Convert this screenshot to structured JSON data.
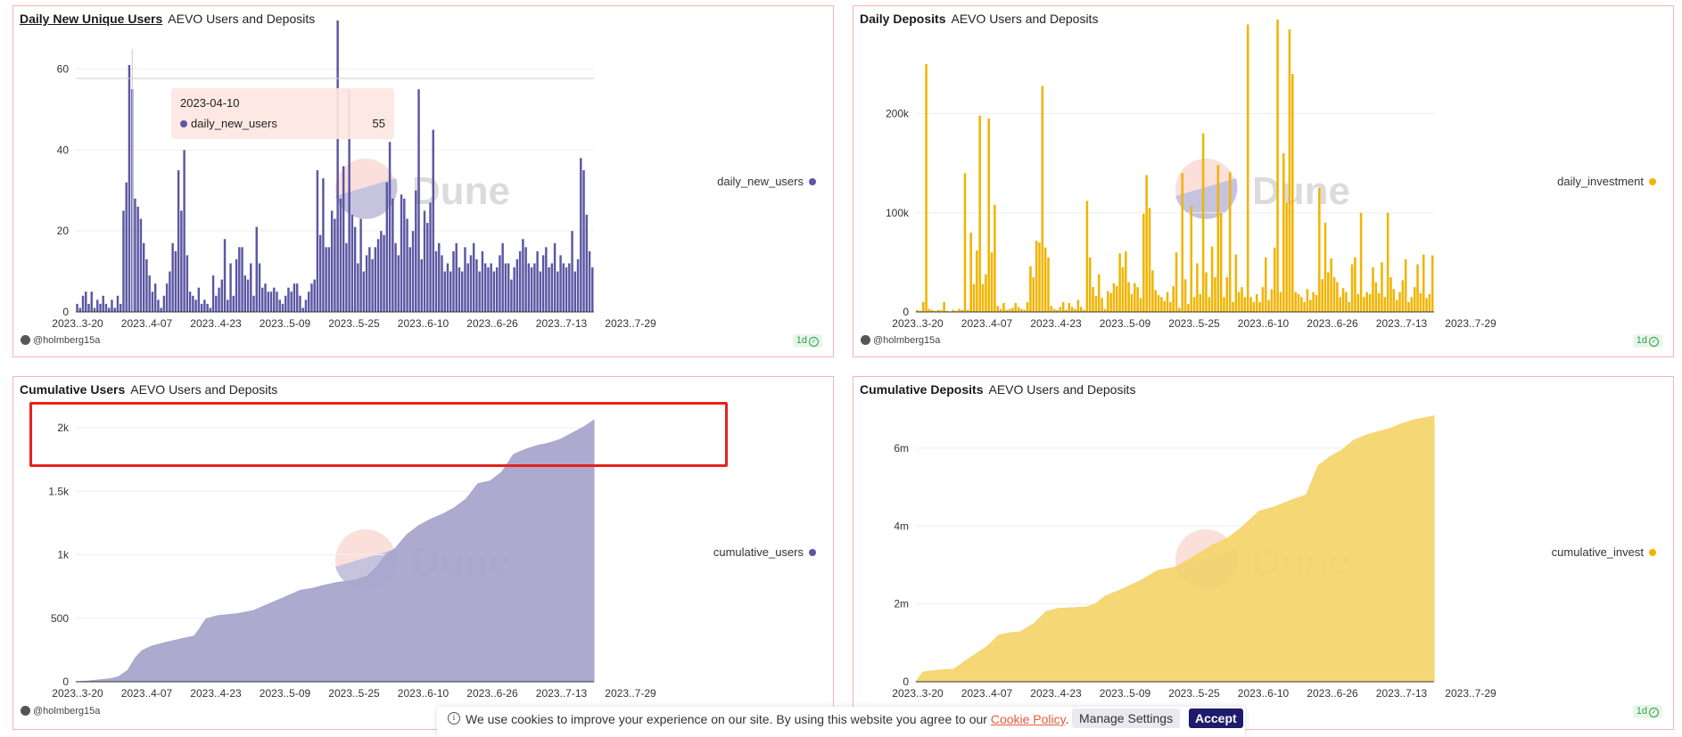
{
  "colors": {
    "purple": "#5b57a3",
    "purple_area": "#a8a6cc",
    "gold": "#f0b400",
    "gold_area": "#f5d56e",
    "panel_border": "#f4b4b0",
    "highlight": "#e5221d"
  },
  "panels": [
    {
      "title": "Daily New Unique Users",
      "subtitle": "AEVO Users and Deposits",
      "legend": "daily_new_users",
      "author": "@holmberg15a",
      "badge": "1d",
      "tooltip": {
        "date": "2023-04-10",
        "series": "daily_new_users",
        "value": "55"
      }
    },
    {
      "title": "Daily Deposits",
      "subtitle": "AEVO Users and Deposits",
      "legend": "daily_investment",
      "author": "@holmberg15a",
      "badge": "1d"
    },
    {
      "title": "Cumulative Users",
      "subtitle": "AEVO Users and Deposits",
      "legend": "cumulative_users",
      "author": "@holmberg15a"
    },
    {
      "title": "Cumulative Deposits",
      "subtitle": "AEVO Users and Deposits",
      "legend": "cumulative_invest",
      "badge": "1d"
    }
  ],
  "cookie": {
    "message": "We use cookies to improve your experience on our site. By using this website you agree to our",
    "link": "Cookie Policy",
    "manage": "Manage Settings",
    "accept": "Accept"
  },
  "chart_data": [
    {
      "type": "bar",
      "series_name": "daily_new_users",
      "x_tick_labels": [
        "2023..3-20",
        "2023..4-07",
        "2023..4-23",
        "2023..5-09",
        "2023..5-25",
        "2023..6-10",
        "2023..6-26",
        "2023..7-13",
        "2023..7-29"
      ],
      "y_ticks": [
        0,
        20,
        40,
        60
      ],
      "y_tick_labels": [
        "0",
        "20",
        "40",
        "60"
      ],
      "ylim": [
        0,
        72
      ],
      "values": [
        2,
        1,
        4,
        5,
        2,
        5,
        1,
        3,
        2,
        4,
        2,
        1,
        3,
        1,
        4,
        2,
        25,
        32,
        61,
        55,
        28,
        26,
        23,
        17,
        13,
        9,
        5,
        7,
        3,
        1,
        4,
        7,
        10,
        17,
        15,
        35,
        25,
        40,
        14,
        5,
        4,
        3,
        6,
        2,
        3,
        2,
        1,
        9,
        4,
        6,
        8,
        18,
        3,
        12,
        4,
        13,
        16,
        16,
        9,
        8,
        12,
        4,
        21,
        12,
        6,
        7,
        5,
        5,
        6,
        5,
        3,
        2,
        4,
        6,
        5,
        7,
        7,
        4,
        1,
        3,
        5,
        7,
        8,
        35,
        19,
        33,
        16,
        16,
        25,
        23,
        72,
        28,
        36,
        17,
        55,
        24,
        21,
        12,
        23,
        10,
        14,
        16,
        13,
        16,
        18,
        20,
        19,
        32,
        42,
        28,
        17,
        14,
        29,
        28,
        23,
        16,
        20,
        30,
        55,
        13,
        25,
        22,
        27,
        45,
        15,
        17,
        14,
        10,
        12,
        10,
        15,
        17,
        11,
        10,
        16,
        12,
        14,
        17,
        13,
        10,
        15,
        12,
        11,
        12,
        10,
        11,
        14,
        17,
        12,
        12,
        8,
        11,
        13,
        15,
        18,
        16,
        12,
        11,
        12,
        15,
        10,
        14,
        16,
        11,
        12,
        17,
        10,
        14,
        12,
        11,
        12,
        20,
        10,
        13,
        38,
        35,
        24,
        15,
        11
      ]
    },
    {
      "type": "bar",
      "series_name": "daily_investment",
      "x_tick_labels": [
        "2023..3-20",
        "2023..4-07",
        "2023..4-23",
        "2023..5-09",
        "2023..5-25",
        "2023..6-10",
        "2023..6-26",
        "2023..7-13",
        "2023..7-29"
      ],
      "y_ticks": [
        0,
        100000,
        200000
      ],
      "y_tick_labels": [
        "0",
        "100k",
        "200k"
      ],
      "ylim": [
        0,
        294000
      ],
      "values": [
        2000,
        1000,
        10000,
        250000,
        3000,
        2000,
        1000,
        2000,
        1500,
        10000,
        1000,
        500,
        2000,
        1000,
        3000,
        2000,
        140000,
        2000,
        80000,
        28000,
        62000,
        198000,
        28000,
        38000,
        195000,
        60000,
        108000,
        6000,
        3000,
        9000,
        2000,
        3000,
        4000,
        9000,
        5000,
        3000,
        2000,
        10000,
        46000,
        35000,
        72000,
        70000,
        228000,
        65000,
        55000,
        6000,
        3000,
        2000,
        5000,
        10000,
        2000,
        9000,
        5000,
        3000,
        12000,
        5000,
        2000,
        112000,
        55000,
        25000,
        16000,
        38000,
        14000,
        3000,
        21000,
        19000,
        29000,
        26000,
        59000,
        45000,
        61000,
        30000,
        18000,
        29000,
        25000,
        14000,
        99000,
        138000,
        105000,
        42000,
        22000,
        17000,
        15000,
        11000,
        20000,
        10000,
        26000,
        60000,
        4000,
        140000,
        33000,
        8000,
        107000,
        15000,
        49000,
        18000,
        180000,
        40000,
        15000,
        66000,
        35000,
        148000,
        100000,
        15000,
        35000,
        141000,
        10000,
        58000,
        20000,
        25000,
        15000,
        290000,
        15000,
        10000,
        18000,
        10000,
        25000,
        55000,
        12000,
        23000,
        65000,
        295000,
        20000,
        160000,
        110000,
        285000,
        240000,
        20000,
        18000,
        15000,
        10000,
        23000,
        12000,
        20000,
        17000,
        125000,
        33000,
        90000,
        40000,
        54000,
        35000,
        30000,
        15000,
        24000,
        20000,
        10000,
        48000,
        55000,
        18000,
        100000,
        15000,
        20000,
        18000,
        45000,
        30000,
        19000,
        50000,
        15000,
        100000,
        35000,
        23000,
        12000,
        20000,
        32000,
        53000,
        10000,
        15000,
        25000,
        48000,
        19000,
        58000,
        14000,
        18000,
        57000
      ]
    },
    {
      "type": "area",
      "series_name": "cumulative_users",
      "x_tick_labels": [
        "2023..3-20",
        "2023..4-07",
        "2023..4-23",
        "2023..5-09",
        "2023..5-25",
        "2023..6-10",
        "2023..6-26",
        "2023..7-13",
        "2023..7-29"
      ],
      "y_ticks": [
        0,
        500,
        1000,
        1500,
        2000
      ],
      "y_tick_labels": [
        "0",
        "500",
        "1k",
        "1.5k",
        "2k"
      ],
      "ylim": [
        0,
        2000
      ],
      "points": [
        [
          0,
          0
        ],
        [
          5,
          5
        ],
        [
          10,
          15
        ],
        [
          15,
          25
        ],
        [
          18,
          40
        ],
        [
          22,
          90
        ],
        [
          25,
          185
        ],
        [
          28,
          245
        ],
        [
          32,
          280
        ],
        [
          38,
          310
        ],
        [
          45,
          340
        ],
        [
          50,
          360
        ],
        [
          52,
          410
        ],
        [
          55,
          495
        ],
        [
          60,
          520
        ],
        [
          68,
          535
        ],
        [
          75,
          560
        ],
        [
          80,
          600
        ],
        [
          85,
          640
        ],
        [
          90,
          680
        ],
        [
          95,
          720
        ],
        [
          100,
          735
        ],
        [
          105,
          760
        ],
        [
          110,
          780
        ],
        [
          118,
          800
        ],
        [
          123,
          830
        ],
        [
          127,
          900
        ],
        [
          131,
          1000
        ],
        [
          135,
          1050
        ],
        [
          140,
          1160
        ],
        [
          145,
          1230
        ],
        [
          150,
          1280
        ],
        [
          155,
          1320
        ],
        [
          160,
          1370
        ],
        [
          165,
          1440
        ],
        [
          170,
          1560
        ],
        [
          175,
          1580
        ],
        [
          180,
          1650
        ],
        [
          185,
          1790
        ],
        [
          190,
          1830
        ],
        [
          195,
          1860
        ],
        [
          200,
          1880
        ],
        [
          205,
          1910
        ],
        [
          210,
          1960
        ],
        [
          215,
          2010
        ],
        [
          219,
          2060
        ]
      ]
    },
    {
      "type": "area",
      "series_name": "cumulative_invest",
      "x_tick_labels": [
        "2023..3-20",
        "2023..4-07",
        "2023..4-23",
        "2023..5-09",
        "2023..5-25",
        "2023..6-10",
        "2023..6-26",
        "2023..7-13",
        "2023..7-29"
      ],
      "y_ticks": [
        0,
        2000000,
        4000000,
        6000000
      ],
      "y_tick_labels": [
        "0",
        "2m",
        "4m",
        "6m"
      ],
      "ylim": [
        0,
        6800000
      ],
      "points": [
        [
          0,
          0
        ],
        [
          3,
          250000
        ],
        [
          10,
          300000
        ],
        [
          16,
          320000
        ],
        [
          20,
          500000
        ],
        [
          25,
          700000
        ],
        [
          30,
          900000
        ],
        [
          35,
          1200000
        ],
        [
          40,
          1260000
        ],
        [
          44,
          1280000
        ],
        [
          50,
          1500000
        ],
        [
          55,
          1800000
        ],
        [
          60,
          1880000
        ],
        [
          66,
          1900000
        ],
        [
          72,
          1920000
        ],
        [
          76,
          2000000
        ],
        [
          80,
          2200000
        ],
        [
          88,
          2400000
        ],
        [
          95,
          2600000
        ],
        [
          102,
          2850000
        ],
        [
          110,
          2950000
        ],
        [
          117,
          3200000
        ],
        [
          125,
          3500000
        ],
        [
          132,
          3700000
        ],
        [
          138,
          3980000
        ],
        [
          145,
          4380000
        ],
        [
          152,
          4500000
        ],
        [
          158,
          4650000
        ],
        [
          165,
          4800000
        ],
        [
          170,
          5550000
        ],
        [
          175,
          5780000
        ],
        [
          180,
          5950000
        ],
        [
          185,
          6200000
        ],
        [
          190,
          6330000
        ],
        [
          195,
          6420000
        ],
        [
          200,
          6500000
        ],
        [
          205,
          6620000
        ],
        [
          210,
          6720000
        ],
        [
          215,
          6780000
        ],
        [
          219,
          6830000
        ]
      ]
    }
  ]
}
